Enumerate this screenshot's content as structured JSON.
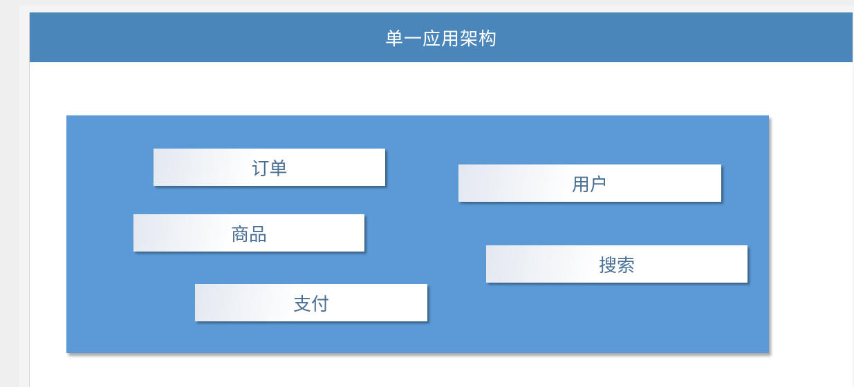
{
  "diagram": {
    "title": "单一应用架构",
    "modules": [
      {
        "id": "order",
        "label": "订单"
      },
      {
        "id": "user",
        "label": "用户"
      },
      {
        "id": "goods",
        "label": "商品"
      },
      {
        "id": "search",
        "label": "搜索"
      },
      {
        "id": "pay",
        "label": "支付"
      }
    ]
  },
  "colors": {
    "header": "#4a86ba",
    "panel": "#5b9ad6",
    "module_text": "#4a6f94"
  }
}
